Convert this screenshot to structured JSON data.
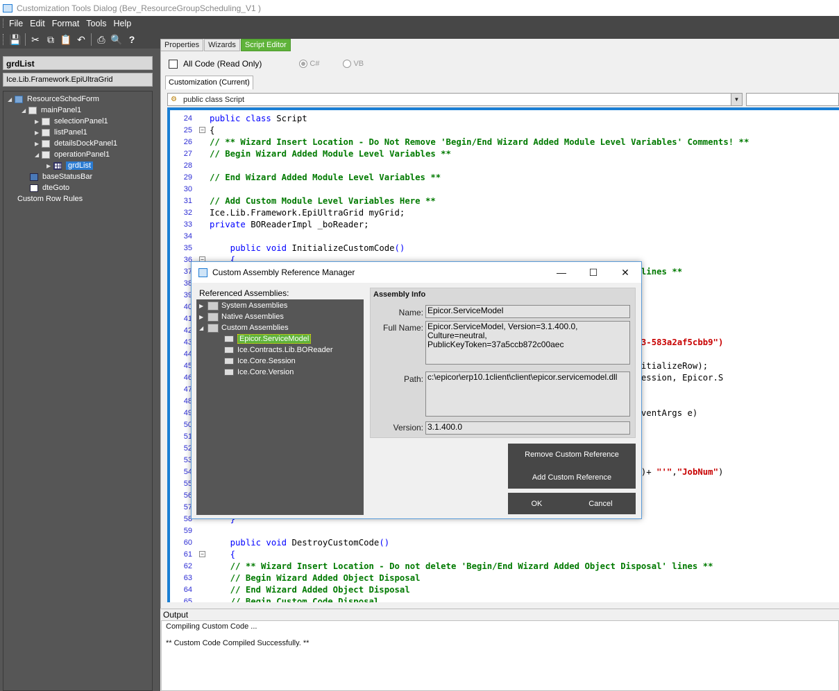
{
  "window": {
    "title": "Customization Tools Dialog  (Bev_ResourceGroupScheduling_V1 )"
  },
  "menu": [
    "File",
    "Edit",
    "Format",
    "Tools",
    "Help"
  ],
  "toolbar_icons": [
    "save-icon",
    "cut-icon",
    "copy-icon",
    "paste-icon",
    "undo-icon",
    "print-icon",
    "find-icon",
    "help-icon"
  ],
  "left": {
    "object_name": "grdList",
    "object_type": "Ice.Lib.Framework.EpiUltraGrid",
    "tree": [
      {
        "label": "ResourceSchedForm",
        "arrow": "◢",
        "icon": "form"
      },
      {
        "label": "mainPanel1",
        "arrow": "◢",
        "icon": "panel"
      },
      {
        "label": "selectionPanel1",
        "arrow": "▶",
        "icon": "panel"
      },
      {
        "label": "listPanel1",
        "arrow": "▶",
        "icon": "panel"
      },
      {
        "label": "detailsDockPanel1",
        "arrow": "▶",
        "icon": "panel"
      },
      {
        "label": "operationPanel1",
        "arrow": "◢",
        "icon": "panel"
      },
      {
        "label": "grdList",
        "arrow": "▶",
        "icon": "grid"
      },
      {
        "label": "baseStatusBar",
        "arrow": "",
        "icon": "status"
      },
      {
        "label": "dteGoto",
        "arrow": "",
        "icon": "date"
      },
      {
        "label": "Custom Row Rules",
        "arrow": "",
        "icon": ""
      }
    ]
  },
  "tabs": [
    "Properties",
    "Wizards",
    "Script Editor"
  ],
  "editor": {
    "all_code_label": "All Code (Read Only)",
    "radio_cs": "C#",
    "radio_vb": "VB",
    "customization_tab": "Customization (Current)",
    "class_selector": "public class Script",
    "lines": [
      {
        "n": "24",
        "parts": [
          [
            "kw",
            "public class "
          ],
          [
            "tx",
            "Script"
          ]
        ]
      },
      {
        "n": "25",
        "parts": [
          [
            "tx",
            "{"
          ]
        ]
      },
      {
        "n": "26",
        "parts": [
          [
            "cm",
            "// ** Wizard Insert Location - Do Not Remove 'Begin/End Wizard Added Module Level Variables' Comments! **"
          ]
        ]
      },
      {
        "n": "27",
        "parts": [
          [
            "cm",
            "// Begin Wizard Added Module Level Variables **"
          ]
        ]
      },
      {
        "n": "28",
        "parts": []
      },
      {
        "n": "29",
        "parts": [
          [
            "cm",
            "// End Wizard Added Module Level Variables **"
          ]
        ]
      },
      {
        "n": "30",
        "parts": []
      },
      {
        "n": "31",
        "parts": [
          [
            "cm",
            "// Add Custom Module Level Variables Here **"
          ]
        ]
      },
      {
        "n": "32",
        "parts": [
          [
            "tx",
            "Ice.Lib.Framework.EpiUltraGrid myGrid;"
          ]
        ]
      },
      {
        "n": "33",
        "parts": [
          [
            "kw",
            "private "
          ],
          [
            "tx",
            "BOReaderImpl _boReader;"
          ]
        ]
      },
      {
        "n": "34",
        "parts": []
      },
      {
        "n": "35",
        "parts": [
          [
            "kw",
            "    public void "
          ],
          [
            "tx",
            "InitializeCustomCode"
          ],
          [
            "kw",
            "()"
          ]
        ]
      },
      {
        "n": "36",
        "parts": [
          [
            "kw",
            "    {"
          ]
        ]
      },
      {
        "n": "37",
        "parts": [
          [
            "tx",
            "                                                                "
          ],
          [
            "cm",
            "ble Initialization' lines **"
          ]
        ]
      },
      {
        "n": "38",
        "parts": []
      },
      {
        "n": "39",
        "parts": []
      },
      {
        "n": "40",
        "parts": []
      },
      {
        "n": "41",
        "parts": []
      },
      {
        "n": "42",
        "parts": []
      },
      {
        "n": "43",
        "parts": [
          [
            "tx",
            "                                                                "
          ],
          [
            "st",
            "f88dc8-1b94-4324-ba83-583a2af5cbb9\")"
          ]
        ]
      },
      {
        "n": "44",
        "parts": []
      },
      {
        "n": "45",
        "parts": [
          [
            "tx",
            "                                                                ntHandler(grdList_InitializeRow);"
          ]
        ]
      },
      {
        "n": "46",
        "parts": [
          [
            "tx",
            "                                                                ore.Session)oTrans.Session, Epicor.S"
          ]
        ]
      },
      {
        "n": "47",
        "parts": []
      },
      {
        "n": "48",
        "parts": []
      },
      {
        "n": "49",
        "parts": [
          [
            "tx",
            "                                                                nGrid.InitializeRowEventArgs e)"
          ]
        ]
      },
      {
        "n": "50",
        "parts": []
      },
      {
        "n": "51",
        "parts": []
      },
      {
        "n": "52",
        "parts": []
      },
      {
        "n": "53",
        "parts": []
      },
      {
        "n": "54",
        "parts": [
          [
            "tx",
            "                                                                "
          ],
          [
            "st",
            "um\""
          ],
          [
            "tx",
            "].Value.ToString()+ "
          ],
          [
            "st",
            "\"'\""
          ],
          [
            "tx",
            ","
          ],
          [
            "st",
            "\"JobNum\""
          ],
          [
            "tx",
            ")"
          ]
        ]
      },
      {
        "n": "55",
        "parts": []
      },
      {
        "n": "56",
        "parts": []
      },
      {
        "n": "57",
        "parts": []
      },
      {
        "n": "58",
        "parts": [
          [
            "kw",
            "    }"
          ]
        ]
      },
      {
        "n": "59",
        "parts": []
      },
      {
        "n": "60",
        "parts": [
          [
            "kw",
            "    public void "
          ],
          [
            "tx",
            "DestroyCustomCode"
          ],
          [
            "kw",
            "()"
          ]
        ]
      },
      {
        "n": "61",
        "parts": [
          [
            "kw",
            "    {"
          ]
        ]
      },
      {
        "n": "62",
        "parts": [
          [
            "cm",
            "    // ** Wizard Insert Location - Do not delete 'Begin/End Wizard Added Object Disposal' lines **"
          ]
        ]
      },
      {
        "n": "63",
        "parts": [
          [
            "cm",
            "    // Begin Wizard Added Object Disposal"
          ]
        ]
      },
      {
        "n": "64",
        "parts": [
          [
            "cm",
            "    // End Wizard Added Object Disposal"
          ]
        ]
      },
      {
        "n": "65",
        "parts": [
          [
            "cm",
            "    // Begin Custom Code Disposal"
          ]
        ]
      }
    ]
  },
  "output": {
    "label": "Output",
    "lines": [
      "Compiling Custom Code ...",
      "** Custom Code Compiled Successfully. **"
    ]
  },
  "dialog": {
    "title": "Custom Assembly Reference Manager",
    "referenced_label": "Referenced Assemblies:",
    "groups": [
      {
        "label": "System Assemblies",
        "arrow": "▶"
      },
      {
        "label": "Native Assemblies",
        "arrow": "▶"
      },
      {
        "label": "Custom Assemblies",
        "arrow": "◢"
      }
    ],
    "custom_items": [
      "Epicor.ServiceModel",
      "Ice.Contracts.Lib.BOReader",
      "Ice.Core.Session",
      "Ice.Core.Version"
    ],
    "info": {
      "header": "Assembly Info",
      "name_label": "Name:",
      "name": "Epicor.ServiceModel",
      "fullname_label": "Full Name:",
      "fullname": "Epicor.ServiceModel, Version=3.1.400.0, Culture=neutral, PublicKeyToken=37a5ccb872c00aec",
      "path_label": "Path:",
      "path": "c:\\epicor\\erp10.1client\\client\\epicor.servicemodel.dll",
      "version_label": "Version:",
      "version": "3.1.400.0"
    },
    "buttons": {
      "remove": "Remove Custom Reference",
      "add": "Add Custom Reference",
      "ok": "OK",
      "cancel": "Cancel"
    }
  }
}
